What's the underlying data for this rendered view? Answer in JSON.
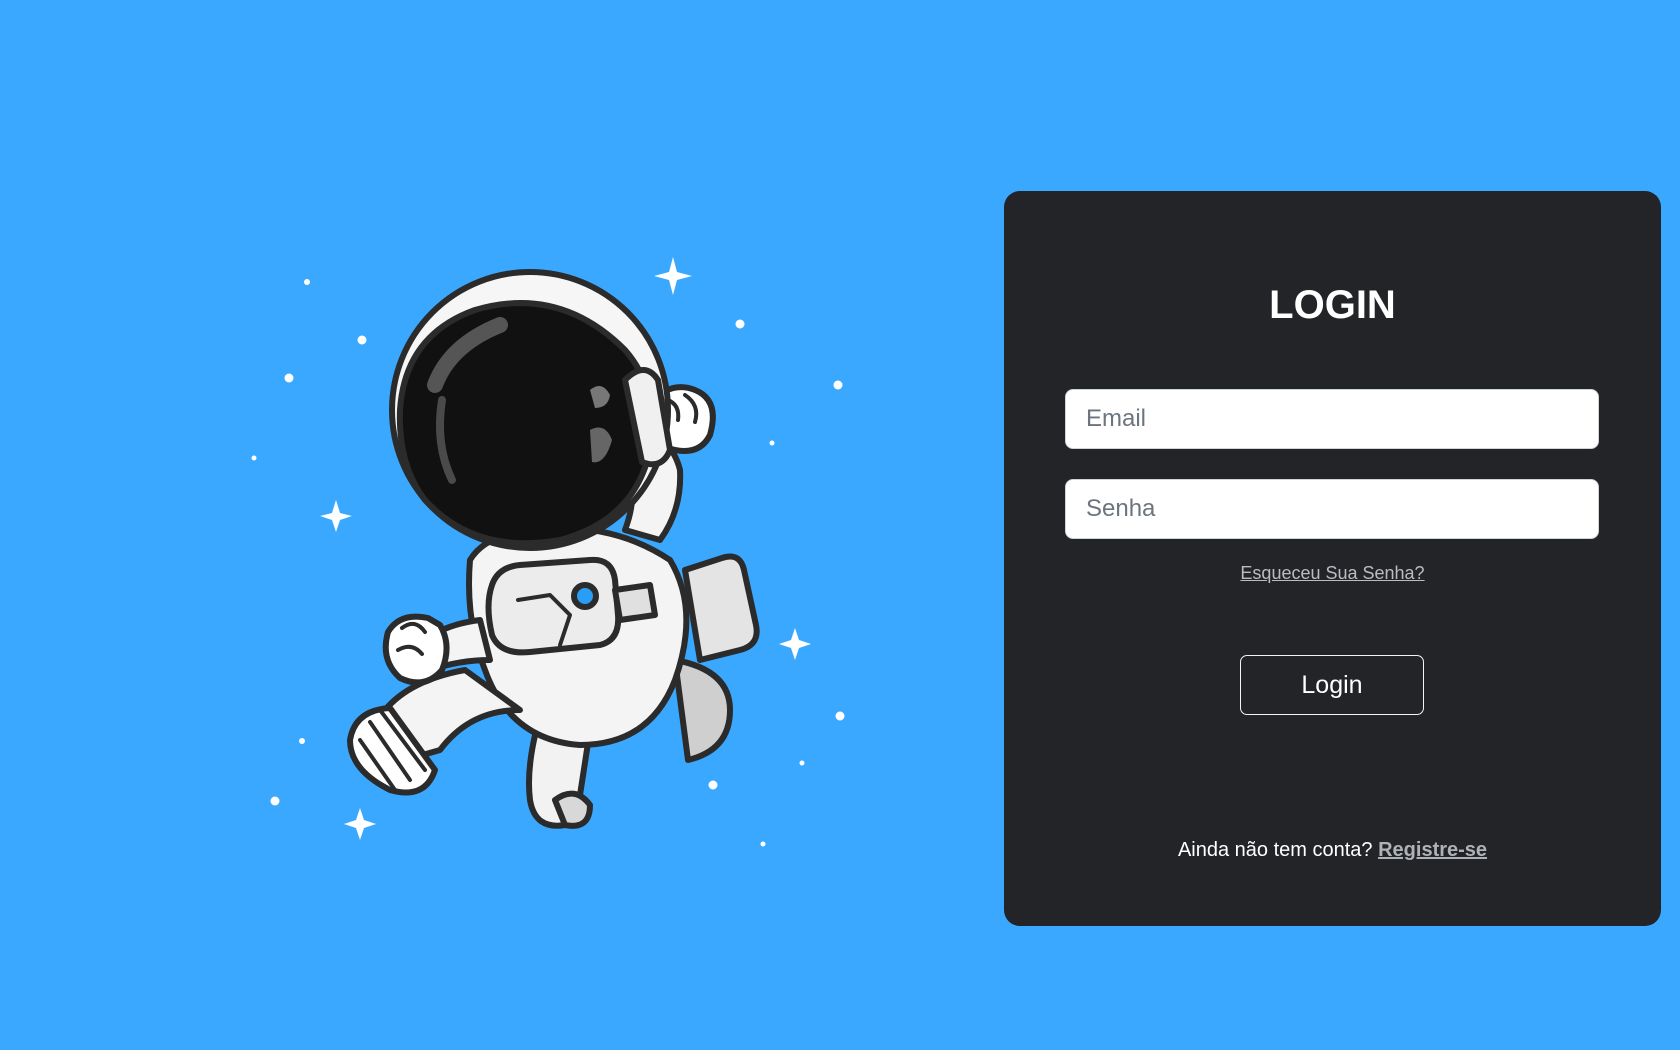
{
  "colors": {
    "background": "#3aa8ff",
    "card": "#222428",
    "text": "#ffffff",
    "link": "#b9bcc0",
    "visor_accent": "#2a9df4"
  },
  "illustration": {
    "icon": "astronaut-illustration"
  },
  "login_card": {
    "title": "LOGIN",
    "email": {
      "value": "",
      "placeholder": "Email"
    },
    "password": {
      "value": "",
      "placeholder": "Senha"
    },
    "forgot_password": "Esqueceu Sua Senha?",
    "login_button": "Login",
    "register_prompt": "Ainda não tem conta?",
    "register_link": "Registre-se"
  }
}
